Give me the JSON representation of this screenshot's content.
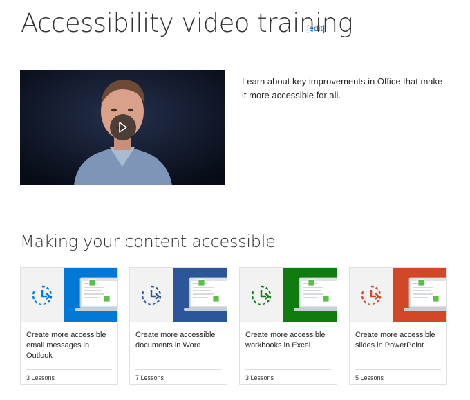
{
  "header": {
    "title": "Accessibility video training",
    "edit_label": "[edit]"
  },
  "intro": {
    "description": "Learn about key improvements in Office that make it more accessible for all."
  },
  "section": {
    "title": "Making your content accessible"
  },
  "cards": [
    {
      "title": "Create more accessible email messages in Outlook",
      "lessons": "3 Lessons",
      "color": "#0078d7",
      "icon_color": "#0078d7"
    },
    {
      "title": "Create more accessible documents in Word",
      "lessons": "7 Lessons",
      "color": "#2b579a",
      "icon_color": "#2b579a"
    },
    {
      "title": "Create more accessible workbooks in Excel",
      "lessons": "3 Lessons",
      "color": "#107c10",
      "icon_color": "#107c10"
    },
    {
      "title": "Create more accessible slides in PowerPoint",
      "lessons": "5 Lessons",
      "color": "#d24726",
      "icon_color": "#d24726"
    }
  ],
  "icons": {
    "play": "play-icon",
    "lesson": "clock-arrow-icon",
    "laptop": "laptop-icon"
  }
}
